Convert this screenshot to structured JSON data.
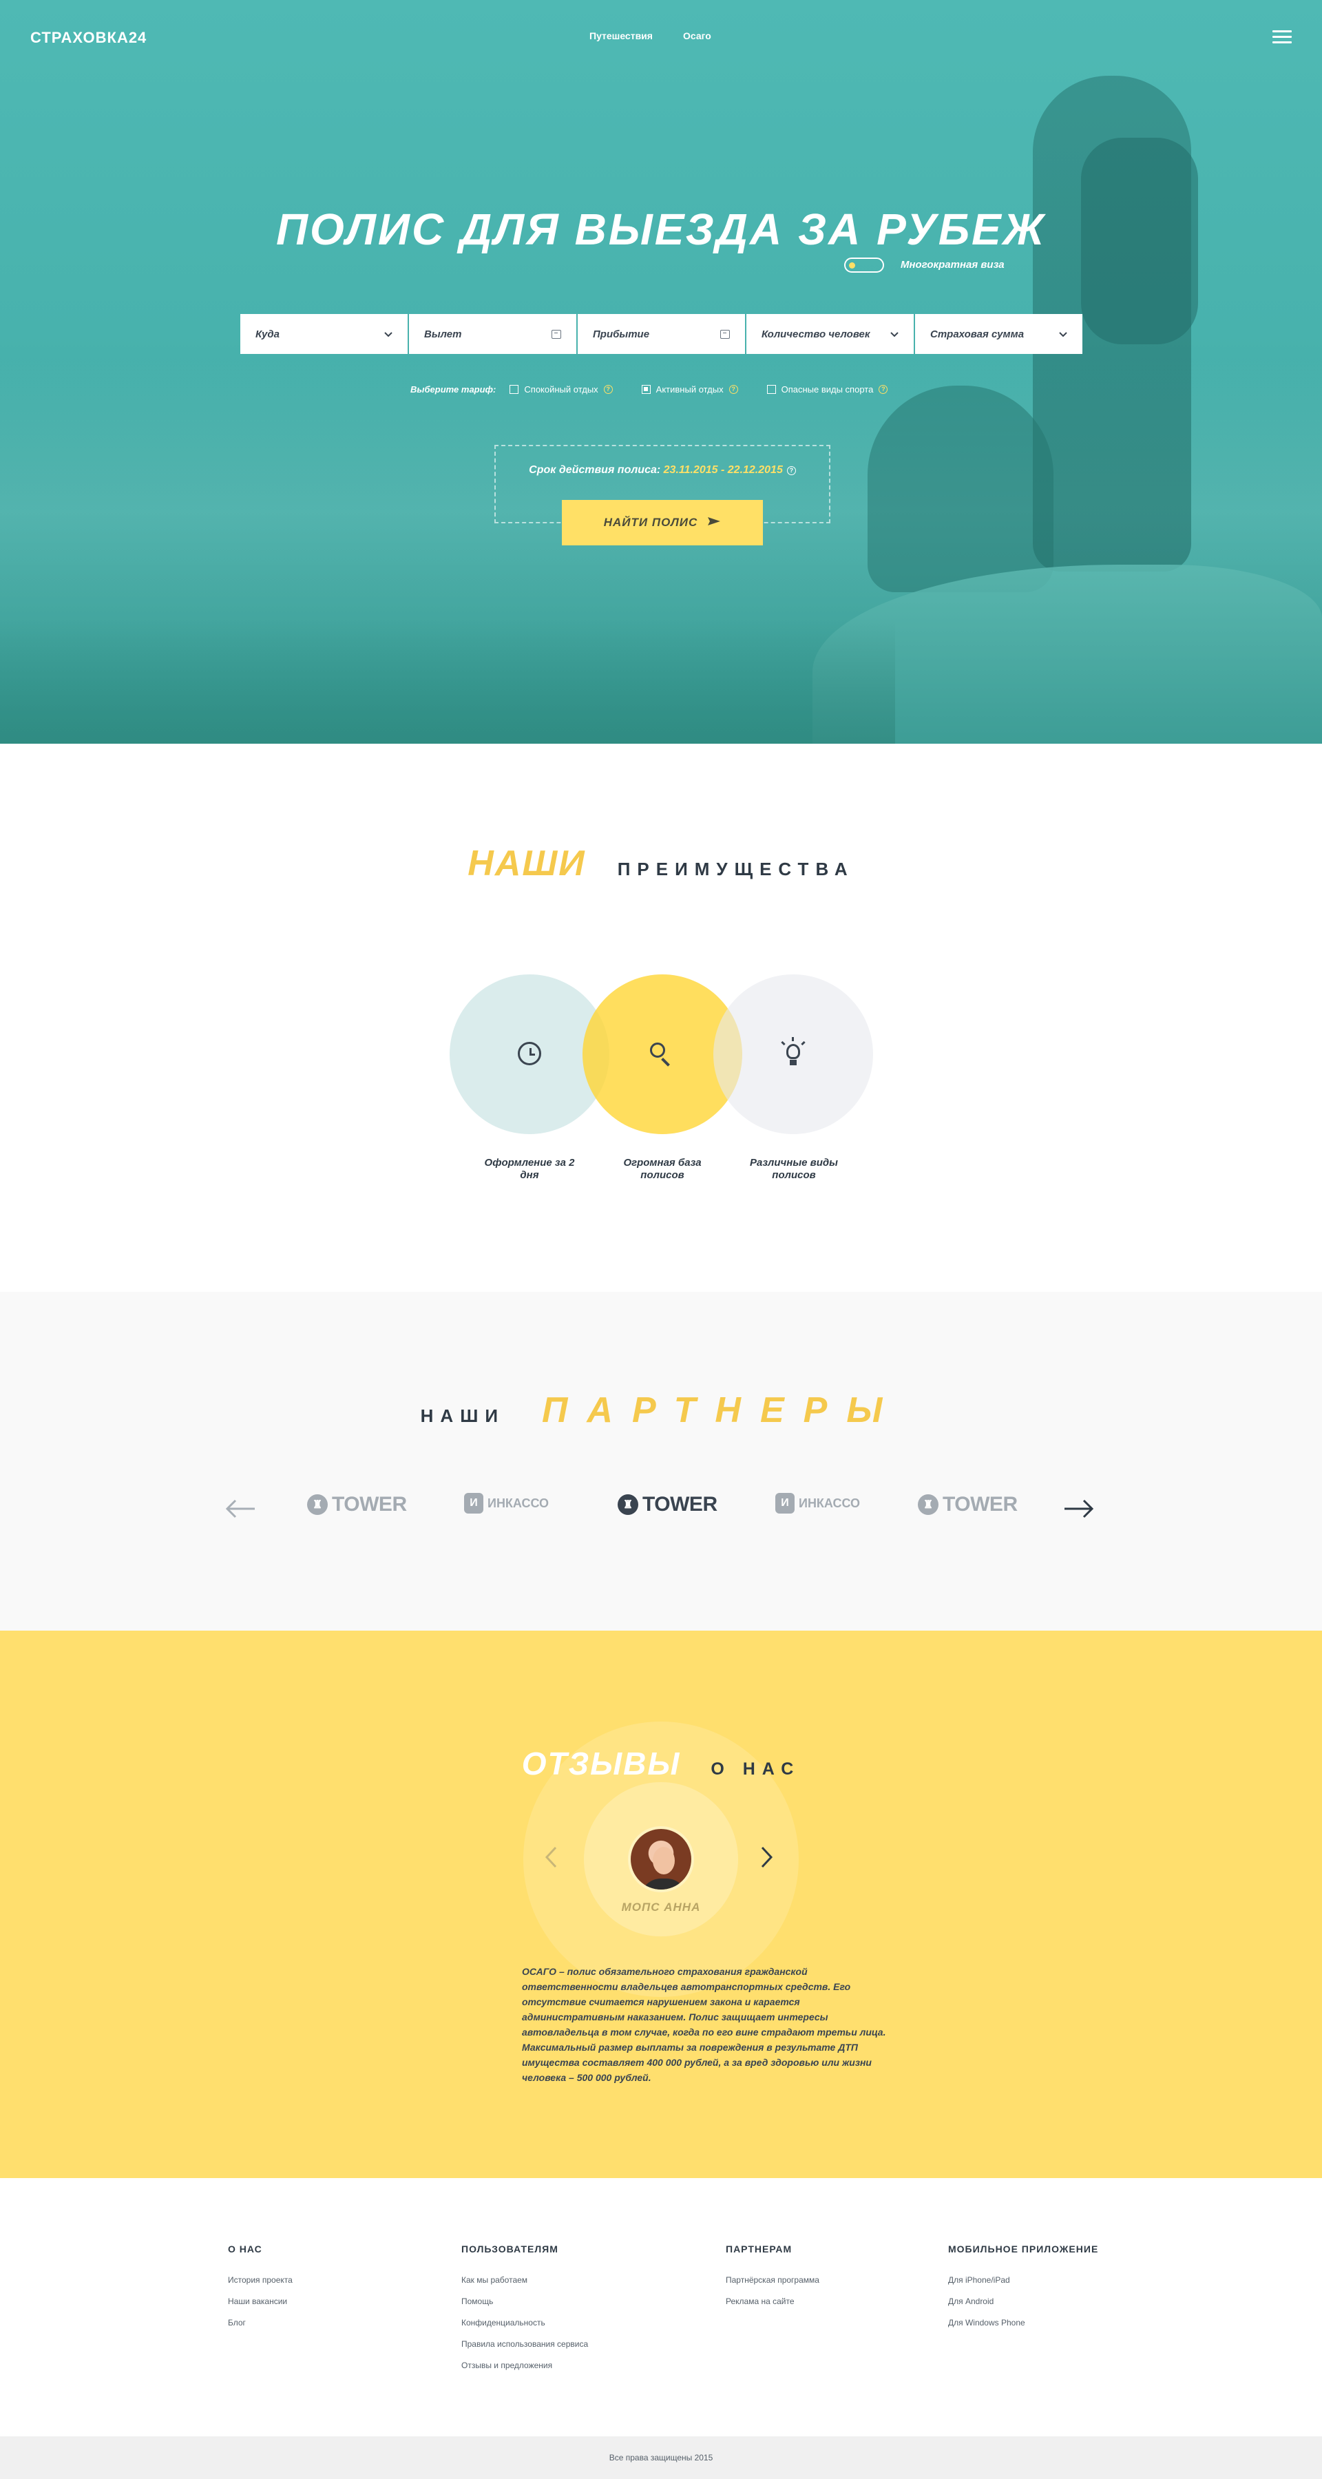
{
  "header": {
    "logo": "СТРАХОВКА24",
    "nav": [
      {
        "label": "Путешествия",
        "active": true
      },
      {
        "label": "Осаго",
        "active": false
      }
    ]
  },
  "hero": {
    "title": "ПОЛИС ДЛЯ ВЫЕЗДА ЗА РУБЕЖ",
    "toggle_label": "Многократная виза",
    "fields": [
      {
        "label": "Куда",
        "icon": "chevron-down-icon"
      },
      {
        "label": "Вылет",
        "icon": "calendar-icon"
      },
      {
        "label": "Прибытие",
        "icon": "calendar-icon"
      },
      {
        "label": "Количество человек",
        "icon": "chevron-down-icon"
      },
      {
        "label": "Страховая сумма",
        "icon": "chevron-down-icon"
      }
    ],
    "tariff": {
      "label": "Выберите тариф:",
      "options": [
        {
          "label": "Спокойный отдых",
          "checked": false
        },
        {
          "label": "Активный отдых",
          "checked": true
        },
        {
          "label": "Опасные виды спорта",
          "checked": false
        }
      ]
    },
    "period": {
      "label": "Срок действия полиса:",
      "dates": "23.11.2015 - 22.12.2015"
    },
    "button": "НАЙТИ ПОЛИС"
  },
  "advantages": {
    "title_accent": "НАШИ",
    "title_rest": "ПРЕИМУЩЕСТВА",
    "items": [
      {
        "label": "Оформление за 2 дня",
        "icon": "clock-icon"
      },
      {
        "label": "Огромная база полисов",
        "icon": "search-icon"
      },
      {
        "label": "Различные виды полисов",
        "icon": "lightbulb-icon"
      }
    ]
  },
  "partners": {
    "title_plain": "НАШИ",
    "title_accent": "ПАРТНЕРЫ",
    "logos": [
      {
        "name": "TOWER",
        "active": false
      },
      {
        "name": "ИНКАССО",
        "active": false
      },
      {
        "name": "TOWER",
        "active": true
      },
      {
        "name": "ИНКАССО",
        "active": false
      },
      {
        "name": "TOWER",
        "active": false
      }
    ]
  },
  "reviews": {
    "title_accent": "ОТЗЫВЫ",
    "title_rest": "О НАС",
    "name": "МОПС АННА",
    "text": "ОСАГО – полис обязательного страхования гражданской ответственности владельцев автотранспортных средств. Его отсутствие считается нарушением закона и карается административным наказанием. Полис защищает интересы автовладельца в том случае, когда по его вине страдают третьи лица. Максимальный размер выплаты за повреждения в результате ДТП имущества составляет 400 000 рублей, а за вред здоровью или жизни человека – 500 000 рублей."
  },
  "footer": {
    "columns": [
      {
        "title": "О НАС",
        "links": [
          "История проекта",
          "Наши вакансии",
          "Блог"
        ]
      },
      {
        "title": "ПОЛЬЗОВАТЕЛЯМ",
        "links": [
          "Как мы работаем",
          "Помощь",
          "Конфиденциальность",
          "Правила использования сервиса",
          "Отзывы и предложения"
        ]
      },
      {
        "title": "ПАРТНЕРАМ",
        "links": [
          "Партнёрская программа",
          "Реклама на сайте"
        ]
      },
      {
        "title": "МОБИЛЬНОЕ ПРИЛОЖЕНИЕ",
        "links": [
          "Для iPhone/iPad",
          "Для Android",
          "Для Windows Phone"
        ]
      }
    ],
    "copyright": "Все права защищены 2015"
  },
  "colors": {
    "accent": "#ffe066",
    "teal": "#4fb9b4",
    "dark": "#2f3a45"
  }
}
